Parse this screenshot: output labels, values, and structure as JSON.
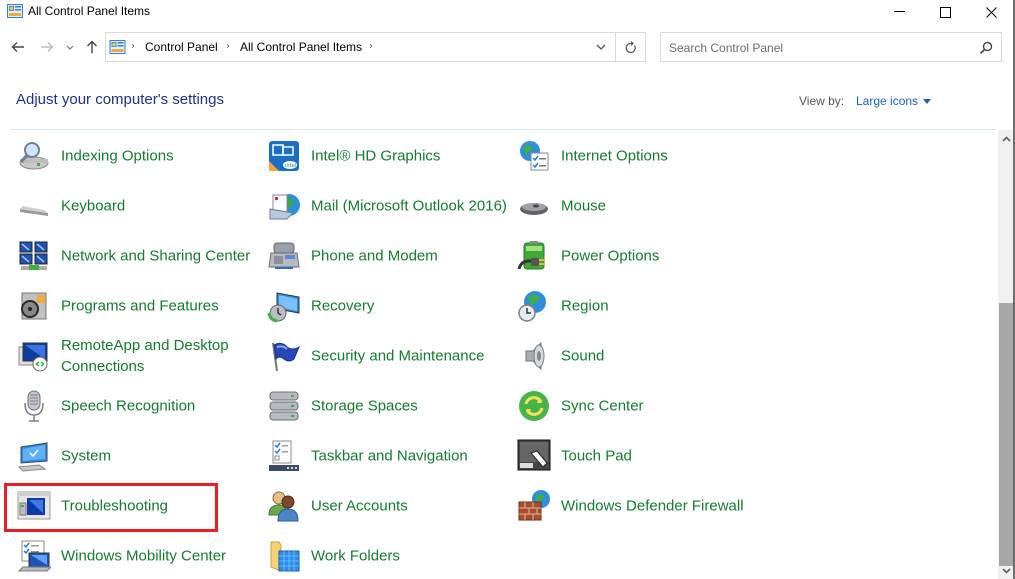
{
  "window": {
    "title": "All Control Panel Items",
    "minimize_label": "Minimize",
    "maximize_label": "Maximize",
    "close_label": "Close"
  },
  "navigation": {
    "breadcrumb": [
      "Control Panel",
      "All Control Panel Items"
    ],
    "search_placeholder": "Search Control Panel",
    "search_value": ""
  },
  "header": {
    "title": "Adjust your computer's settings",
    "view_by_label": "View by:",
    "view_by_value": "Large icons"
  },
  "items": [
    {
      "label": "Indexing Options",
      "icon": "indexing-options-icon",
      "col": 0,
      "row": 0
    },
    {
      "label": "Intel® HD Graphics",
      "icon": "intel-graphics-icon",
      "col": 1,
      "row": 0
    },
    {
      "label": "Internet Options",
      "icon": "internet-options-icon",
      "col": 2,
      "row": 0
    },
    {
      "label": "Keyboard",
      "icon": "keyboard-icon",
      "col": 0,
      "row": 1
    },
    {
      "label": "Mail (Microsoft Outlook 2016)",
      "icon": "mail-icon",
      "col": 1,
      "row": 1
    },
    {
      "label": "Mouse",
      "icon": "mouse-icon",
      "col": 2,
      "row": 1
    },
    {
      "label": "Network and Sharing Center",
      "icon": "network-icon",
      "col": 0,
      "row": 2
    },
    {
      "label": "Phone and Modem",
      "icon": "phone-modem-icon",
      "col": 1,
      "row": 2
    },
    {
      "label": "Power Options",
      "icon": "power-options-icon",
      "col": 2,
      "row": 2
    },
    {
      "label": "Programs and Features",
      "icon": "programs-features-icon",
      "col": 0,
      "row": 3
    },
    {
      "label": "Recovery",
      "icon": "recovery-icon",
      "col": 1,
      "row": 3
    },
    {
      "label": "Region",
      "icon": "region-icon",
      "col": 2,
      "row": 3
    },
    {
      "label": "RemoteApp and Desktop Connections",
      "icon": "remoteapp-icon",
      "col": 0,
      "row": 4
    },
    {
      "label": "Security and Maintenance",
      "icon": "security-flag-icon",
      "col": 1,
      "row": 4
    },
    {
      "label": "Sound",
      "icon": "sound-icon",
      "col": 2,
      "row": 4
    },
    {
      "label": "Speech Recognition",
      "icon": "microphone-icon",
      "col": 0,
      "row": 5
    },
    {
      "label": "Storage Spaces",
      "icon": "storage-spaces-icon",
      "col": 1,
      "row": 5
    },
    {
      "label": "Sync Center",
      "icon": "sync-center-icon",
      "col": 2,
      "row": 5
    },
    {
      "label": "System",
      "icon": "system-icon",
      "col": 0,
      "row": 6
    },
    {
      "label": "Taskbar and Navigation",
      "icon": "taskbar-icon",
      "col": 1,
      "row": 6
    },
    {
      "label": "Touch Pad",
      "icon": "touch-pad-icon",
      "col": 2,
      "row": 6
    },
    {
      "label": "Troubleshooting",
      "icon": "troubleshooting-icon",
      "col": 0,
      "row": 7,
      "highlighted": true
    },
    {
      "label": "User Accounts",
      "icon": "user-accounts-icon",
      "col": 1,
      "row": 7
    },
    {
      "label": "Windows Defender Firewall",
      "icon": "firewall-icon",
      "col": 2,
      "row": 7
    },
    {
      "label": "Windows Mobility Center",
      "icon": "mobility-center-icon",
      "col": 0,
      "row": 8
    },
    {
      "label": "Work Folders",
      "icon": "work-folders-icon",
      "col": 1,
      "row": 8
    }
  ],
  "colors": {
    "link_green": "#167a2f",
    "title_blue": "#1e3287",
    "highlight_red": "#e81e25"
  }
}
